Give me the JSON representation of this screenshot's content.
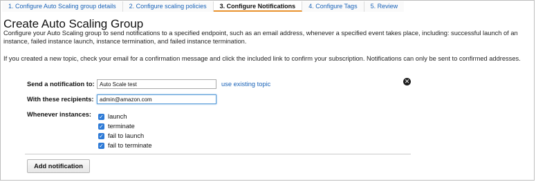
{
  "tabs": [
    {
      "label": "1. Configure Auto Scaling group details"
    },
    {
      "label": "2. Configure scaling policies"
    },
    {
      "label": "3. Configure Notifications"
    },
    {
      "label": "4. Configure Tags"
    },
    {
      "label": "5. Review"
    }
  ],
  "active_tab_index": 2,
  "page": {
    "title": "Create Auto Scaling Group",
    "description": "Configure your Auto Scaling group to send notifications to a specified endpoint, such as an email address, whenever a specified event takes place, including: successful launch of an instance, failed instance launch, instance termination, and failed instance termination.",
    "confirmation_note": "If you created a new topic, check your email for a confirmation message and click the included link to confirm your subscription. Notifications can only be sent to confirmed addresses."
  },
  "form": {
    "send_label": "Send a notification to:",
    "send_value": "Auto Scale test",
    "use_existing_link": "use existing topic",
    "recipients_label": "With these recipients:",
    "recipients_value": "admin@amazon.com",
    "whenever_label": "Whenever instances:",
    "events": [
      {
        "label": "launch",
        "checked": true
      },
      {
        "label": "terminate",
        "checked": true
      },
      {
        "label": "fail to launch",
        "checked": true
      },
      {
        "label": "fail to terminate",
        "checked": true
      }
    ],
    "remove_icon": "close-circle-icon",
    "check_glyph": "✓",
    "remove_glyph": "✕"
  },
  "actions": {
    "add_notification_label": "Add notification"
  },
  "colors": {
    "link": "#1a63b8",
    "active_tab_underline": "#e8912c",
    "checkbox": "#2d7ad6"
  }
}
